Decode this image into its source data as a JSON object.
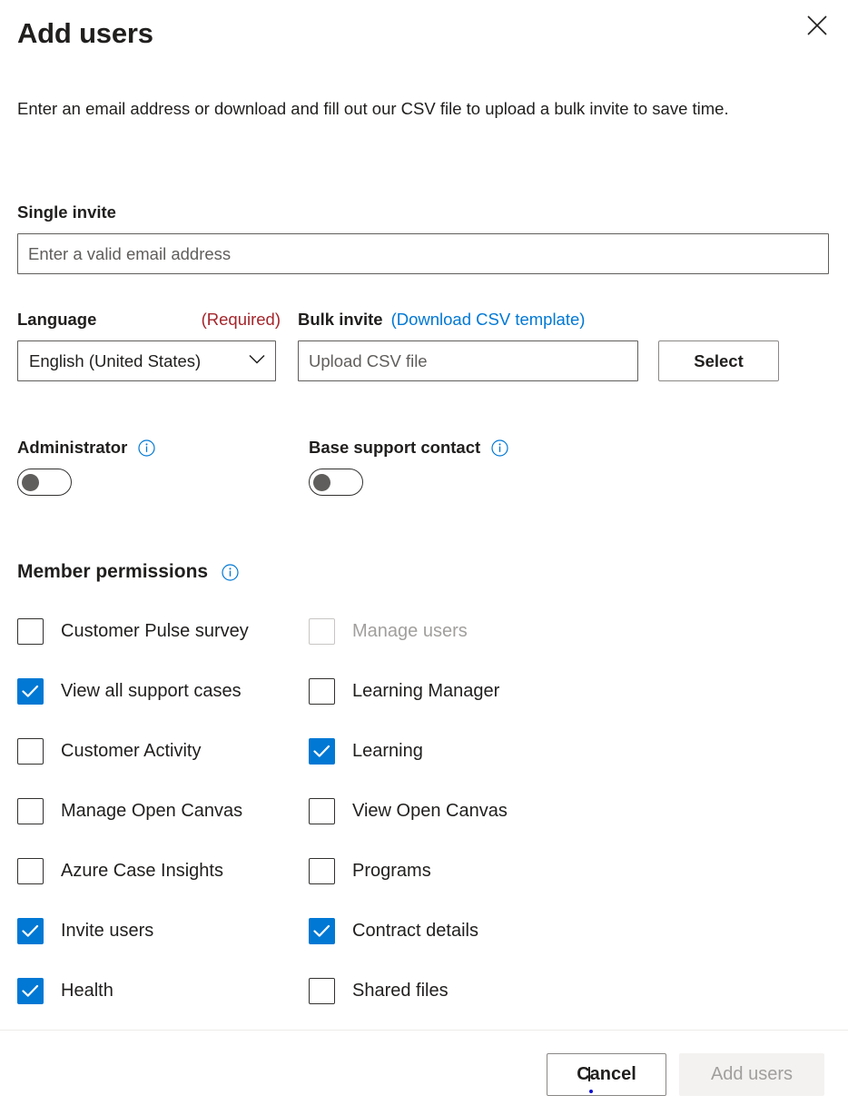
{
  "dialog": {
    "title": "Add users",
    "description": "Enter an email address or download and fill out our CSV file to upload a bulk invite to save time.",
    "close_icon": "close-icon"
  },
  "single_invite": {
    "label": "Single invite",
    "placeholder": "Enter a valid email address",
    "value": ""
  },
  "language": {
    "label": "Language",
    "required_tag": "(Required)",
    "selected": "English (United States)",
    "chevron_icon": "chevron-down-icon"
  },
  "bulk_invite": {
    "label": "Bulk invite",
    "download_link": "(Download CSV template)",
    "placeholder": "Upload CSV file",
    "value": "",
    "select_button": "Select"
  },
  "toggles": [
    {
      "label": "Administrator",
      "state": "off",
      "info_icon": "info-icon"
    },
    {
      "label": "Base support contact",
      "state": "off",
      "info_icon": "info-icon"
    }
  ],
  "member_permissions": {
    "title": "Member permissions",
    "info_icon": "info-icon",
    "left_column": [
      {
        "label": "Customer Pulse survey",
        "checked": false,
        "disabled": false
      },
      {
        "label": "View all support cases",
        "checked": true,
        "disabled": false
      },
      {
        "label": "Customer Activity",
        "checked": false,
        "disabled": false
      },
      {
        "label": "Manage Open Canvas",
        "checked": false,
        "disabled": false
      },
      {
        "label": "Azure Case Insights",
        "checked": false,
        "disabled": false
      },
      {
        "label": "Invite users",
        "checked": true,
        "disabled": false
      },
      {
        "label": "Health",
        "checked": true,
        "disabled": false
      }
    ],
    "right_column": [
      {
        "label": "Manage users",
        "checked": false,
        "disabled": true
      },
      {
        "label": "Learning Manager",
        "checked": false,
        "disabled": false
      },
      {
        "label": "Learning",
        "checked": true,
        "disabled": false
      },
      {
        "label": "View Open Canvas",
        "checked": false,
        "disabled": false
      },
      {
        "label": "Programs",
        "checked": false,
        "disabled": false
      },
      {
        "label": "Contract details",
        "checked": true,
        "disabled": false
      },
      {
        "label": "Shared files",
        "checked": false,
        "disabled": false
      }
    ]
  },
  "footer": {
    "cancel_label": "Cancel",
    "submit_label": "Add users",
    "submit_enabled": false
  },
  "colors": {
    "accent": "#0078d4",
    "required_red": "#a4262c",
    "link_blue": "#0078d4",
    "disabled_text": "#a19f9d",
    "disabled_bg": "#f3f2f1",
    "border": "#605e5c",
    "text": "#201f1e"
  }
}
